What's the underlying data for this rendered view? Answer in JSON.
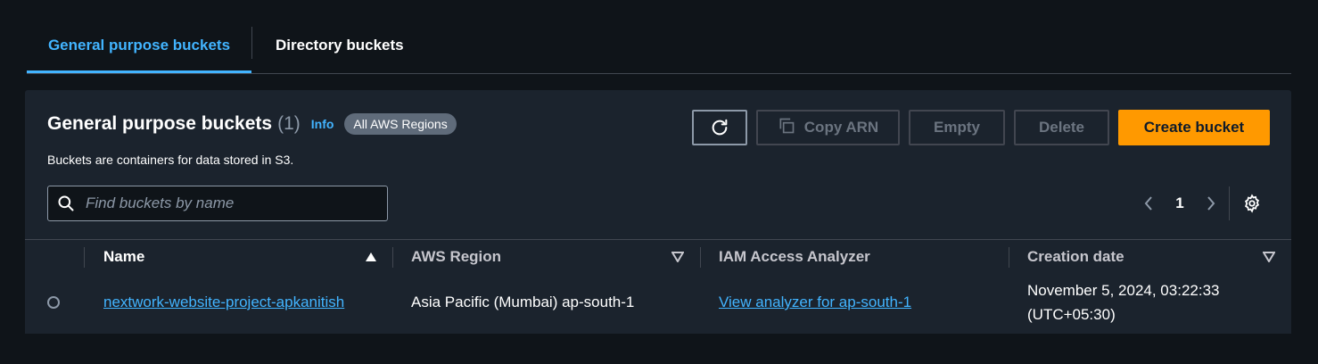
{
  "tabs": {
    "general": "General purpose buckets",
    "directory": "Directory buckets"
  },
  "header": {
    "title": "General purpose buckets",
    "count": "(1)",
    "info": "Info",
    "region_badge": "All AWS Regions",
    "subtitle": "Buckets are containers for data stored in S3."
  },
  "actions": {
    "copy_arn": "Copy ARN",
    "empty": "Empty",
    "delete": "Delete",
    "create": "Create bucket"
  },
  "search": {
    "placeholder": "Find buckets by name"
  },
  "pagination": {
    "page": "1"
  },
  "table": {
    "columns": [
      "Name",
      "AWS Region",
      "IAM Access Analyzer",
      "Creation date"
    ],
    "rows": [
      {
        "name": "nextwork-website-project-apkanitish",
        "region": "Asia Pacific (Mumbai) ap-south-1",
        "analyzer": "View analyzer for ap-south-1",
        "date_line1": "November 5, 2024, 03:22:33",
        "date_line2": "(UTC+05:30)"
      }
    ]
  },
  "colors": {
    "accent": "#42b4ff",
    "create_button": "#ff9900",
    "background": "#0f1419",
    "panel": "#1b232d"
  }
}
